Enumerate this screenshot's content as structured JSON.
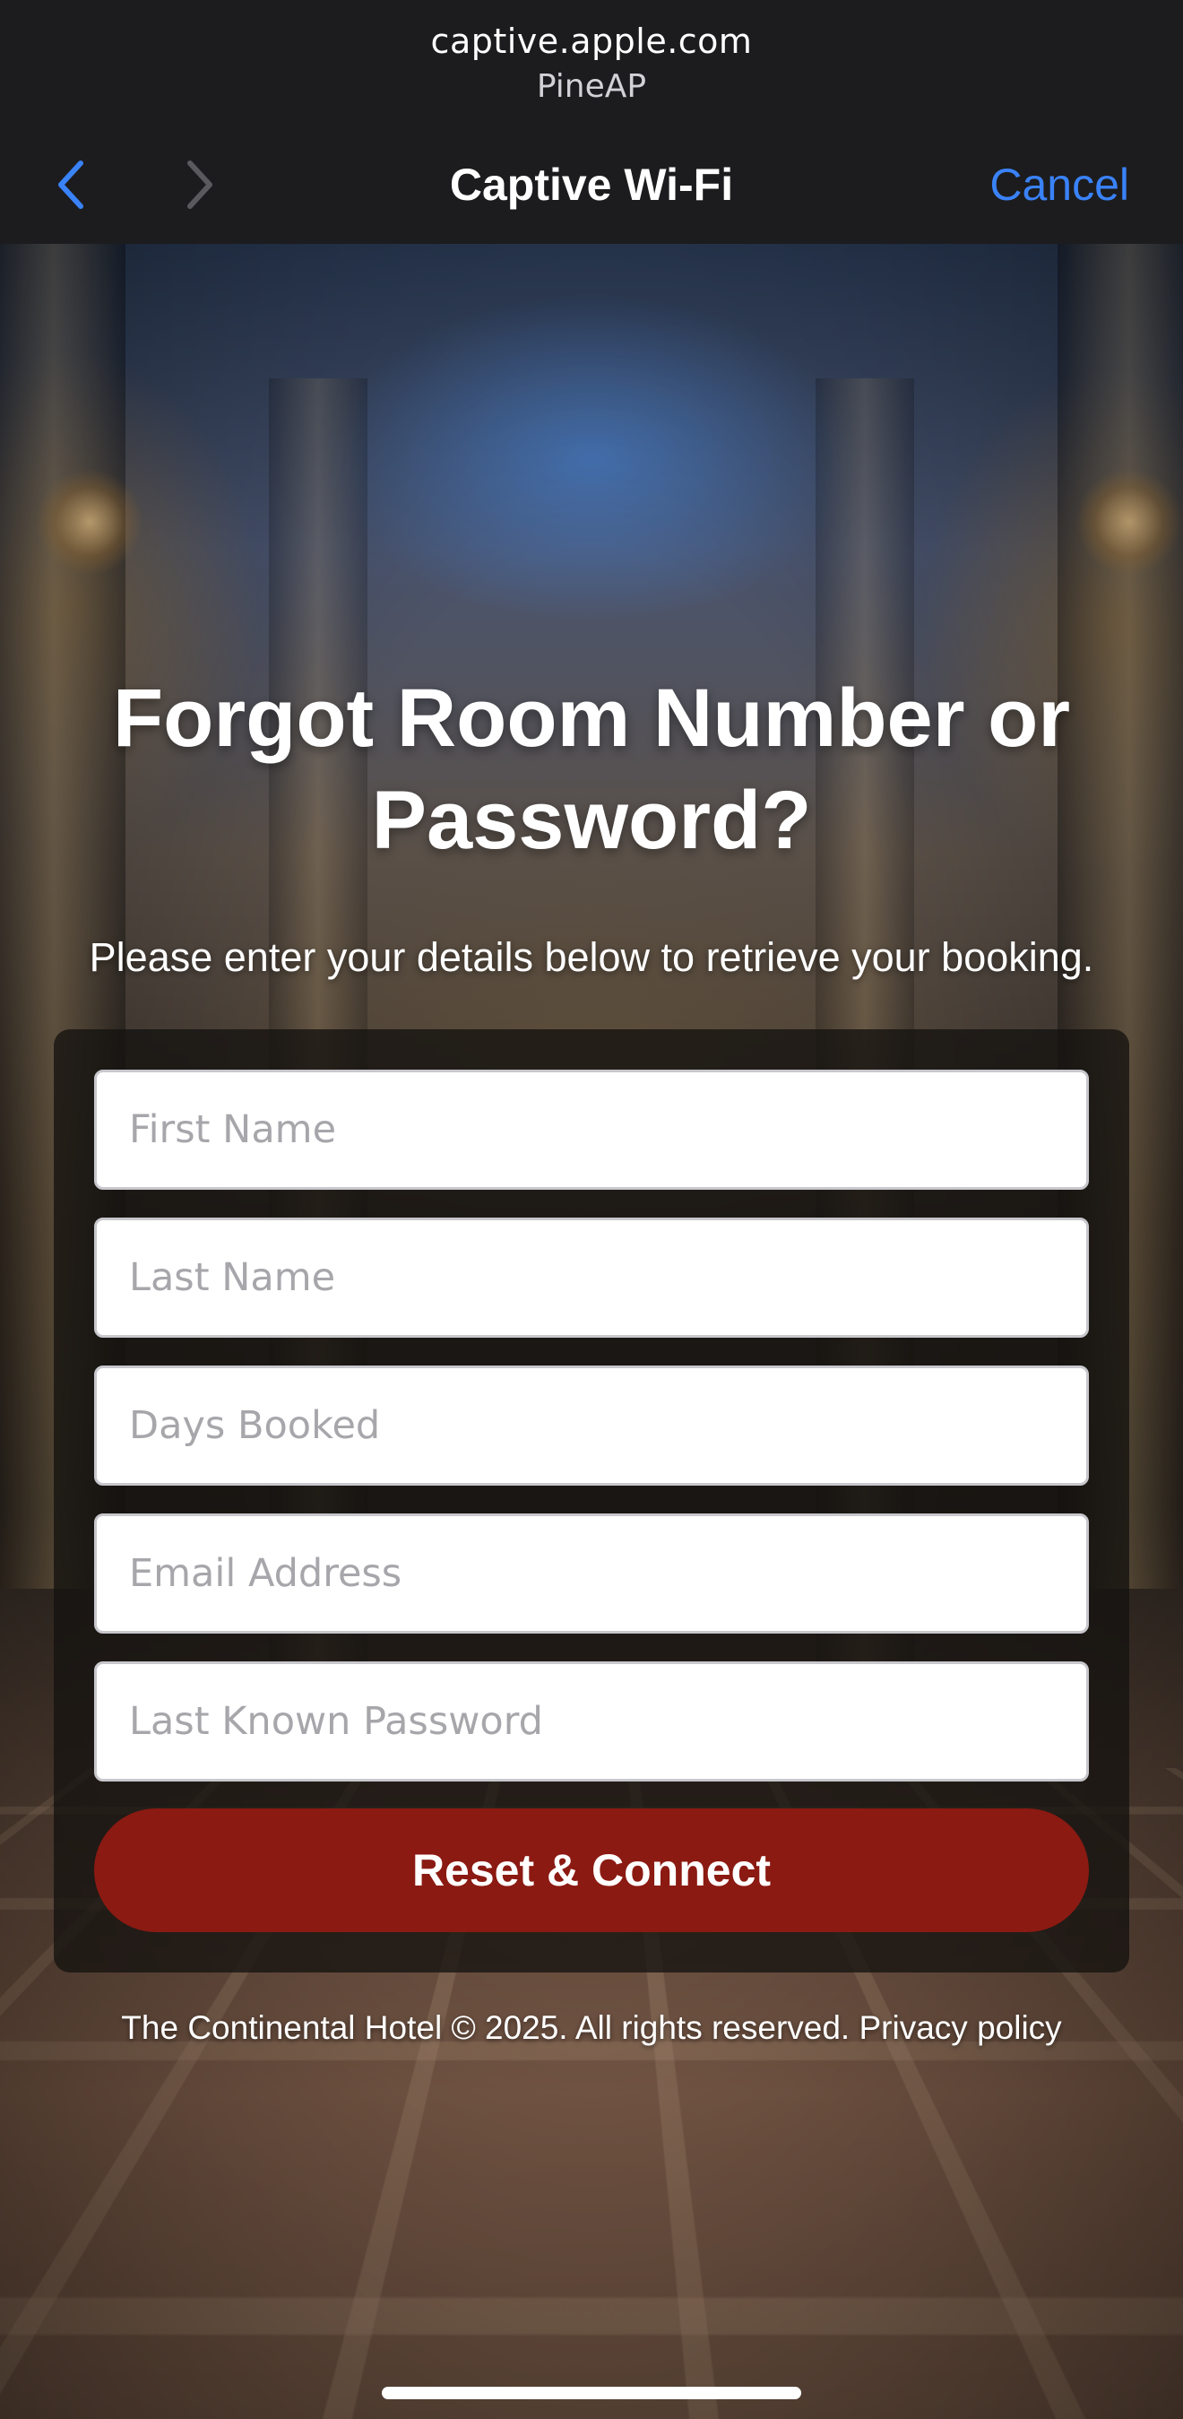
{
  "browser": {
    "url": "captive.apple.com",
    "network": "PineAP",
    "title": "Captive Wi-Fi",
    "cancel_label": "Cancel",
    "accent_color": "#3a82f7"
  },
  "page": {
    "heading": "Forgot Room Number or Password?",
    "subheading": "Please enter your details below to retrieve your booking.",
    "form": {
      "first_name_placeholder": "First Name",
      "last_name_placeholder": "Last Name",
      "days_booked_placeholder": "Days Booked",
      "email_placeholder": "Email Address",
      "password_placeholder": "Last Known Password",
      "submit_label": "Reset & Connect",
      "submit_color": "#8b1a12"
    },
    "footer": {
      "copyright": "The Continental Hotel © 2025. All rights reserved.",
      "privacy_link": "Privacy policy"
    }
  }
}
